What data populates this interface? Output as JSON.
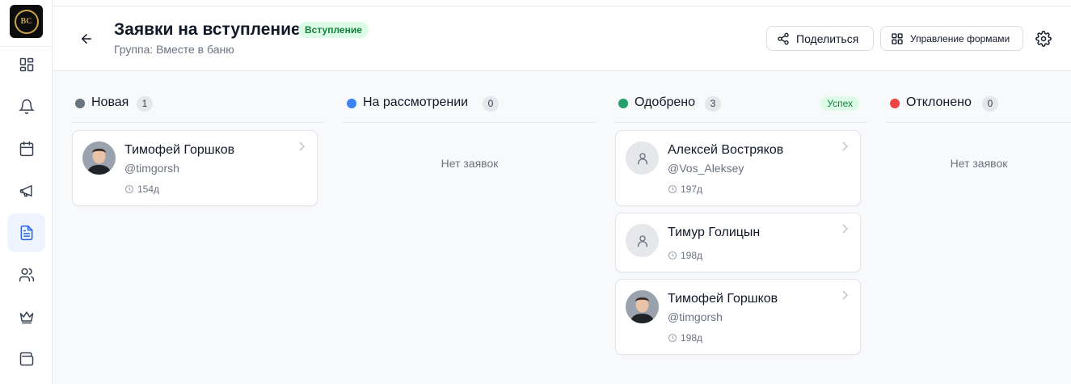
{
  "header": {
    "title": "Заявки на вступление",
    "badge": "Вступление",
    "subtitle": "Группа: Вместе в баню",
    "share_label": "Поделиться",
    "manage_label": "Управление формами"
  },
  "sidebar": {
    "items": [
      {
        "icon": "dashboard-icon"
      },
      {
        "icon": "bell-icon"
      },
      {
        "icon": "calendar-icon"
      },
      {
        "icon": "megaphone-icon"
      },
      {
        "icon": "document-icon",
        "active": true
      },
      {
        "icon": "users-icon"
      },
      {
        "icon": "crown-icon"
      },
      {
        "icon": "wallet-icon"
      }
    ]
  },
  "columns": [
    {
      "title": "Новая",
      "count": "1",
      "color": "#6b7280",
      "cards": [
        {
          "name": "Тимофей Горшков",
          "username": "@timgorsh",
          "age": "154д",
          "avatar": "photo"
        }
      ]
    },
    {
      "title": "На рассмотрении",
      "count": "0",
      "color": "#3b82f6",
      "empty": "Нет заявок"
    },
    {
      "title": "Одобрено",
      "count": "3",
      "color": "#22a06b",
      "tag": "Успех",
      "cards": [
        {
          "name": "Алексей Востряков",
          "username": "@Vos_Aleksey",
          "age": "197д",
          "avatar": "placeholder"
        },
        {
          "name": "Тимур Голицын",
          "username": "",
          "age": "198д",
          "avatar": "placeholder"
        },
        {
          "name": "Тимофей Горшков",
          "username": "@timgorsh",
          "age": "198д",
          "avatar": "photo"
        }
      ]
    },
    {
      "title": "Отклонено",
      "count": "0",
      "color": "#ef4444",
      "empty": "Нет заявок"
    }
  ]
}
